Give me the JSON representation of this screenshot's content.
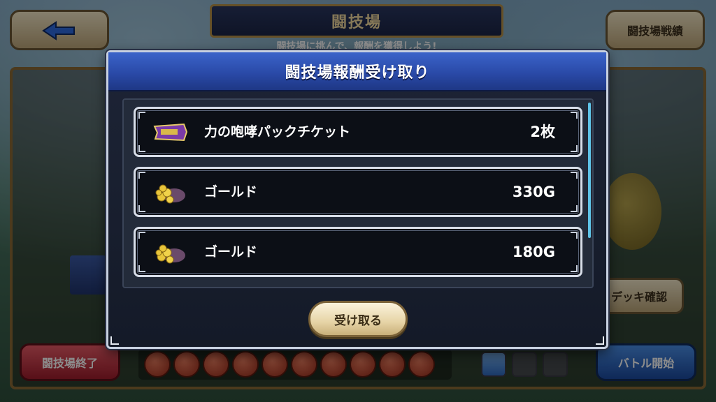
{
  "background": {
    "title": "闘技場",
    "subtitle": "闘技場に挑んで、報酬を獲得しよう!",
    "record_button": "闘技場戦績",
    "deck_button": "デッキ確認",
    "end_button": "闘技場終了",
    "start_button": "バトル開始"
  },
  "modal": {
    "title": "闘技場報酬受け取り",
    "rewards": [
      {
        "icon": "ticket-icon",
        "name": "力の咆哮パックチケット",
        "quantity": "2枚"
      },
      {
        "icon": "gold-pile-icon",
        "name": "ゴールド",
        "quantity": "330G"
      },
      {
        "icon": "gold-pile-icon",
        "name": "ゴールド",
        "quantity": "180G"
      }
    ],
    "receive_button": "受け取る"
  },
  "colors": {
    "header_blue": "#2a4aa8",
    "row_bg": "#0c0f16",
    "scroll_accent": "#5fc4e8"
  }
}
